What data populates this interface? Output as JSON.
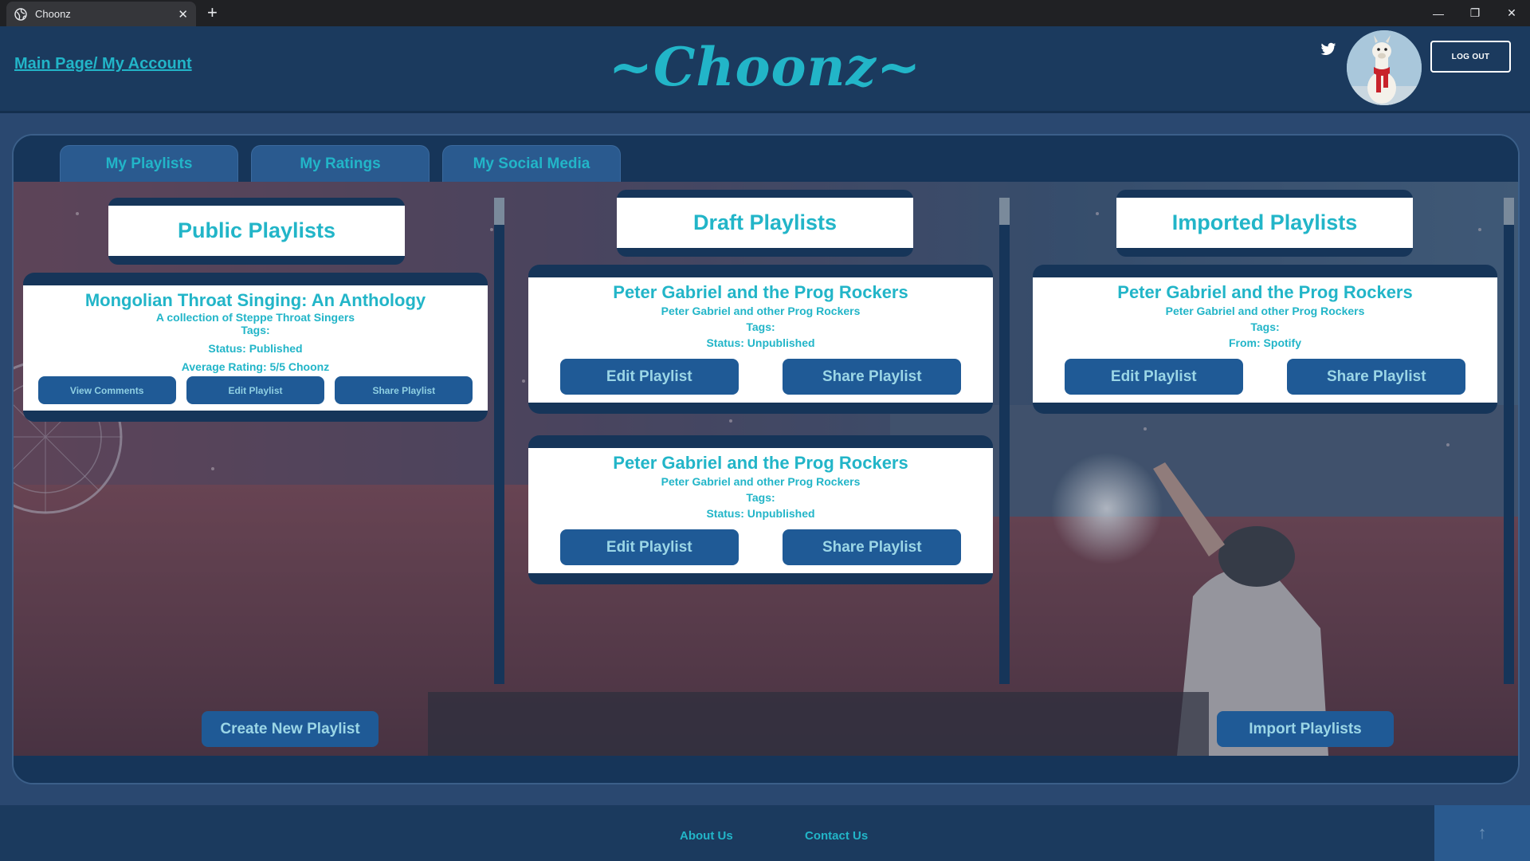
{
  "browser": {
    "tab_title": "Choonz",
    "new_tab": "+",
    "close_tab": "✕",
    "minimize": "—",
    "restore": "❐",
    "close_window": "✕"
  },
  "header": {
    "nav_link": "Main Page/ My Account",
    "logo": "~Choonz~",
    "logout_label": "LOG OUT",
    "icons": [
      "twitter-icon",
      "avatar"
    ]
  },
  "tabs": [
    {
      "label": "My Playlists"
    },
    {
      "label": "My Ratings"
    },
    {
      "label": "My Social Media"
    }
  ],
  "public": {
    "title": "Public Playlists",
    "cards": [
      {
        "title": "Mongolian Throat Singing: An Anthology",
        "subtitle": "A collection of Steppe Throat Singers",
        "tags": "Tags:",
        "status": "Status: Published",
        "rating": "Average Rating: 5/5 Choonz",
        "buttons": [
          "View Comments",
          "Edit Playlist",
          "Share Playlist"
        ]
      }
    ],
    "action": "Create New Playlist"
  },
  "draft": {
    "title": "Draft Playlists",
    "cards": [
      {
        "title": "Peter Gabriel and the Prog Rockers",
        "subtitle": "Peter Gabriel and other Prog Rockers",
        "tags": "Tags:",
        "status": "Status: Unpublished",
        "buttons": [
          "Edit Playlist",
          "Share Playlist"
        ]
      },
      {
        "title": "Peter Gabriel and the Prog Rockers",
        "subtitle": "Peter Gabriel and other Prog Rockers",
        "tags": "Tags:",
        "status": "Status: Unpublished",
        "buttons": [
          "Edit Playlist",
          "Share Playlist"
        ]
      }
    ]
  },
  "imported": {
    "title": "Imported Playlists",
    "cards": [
      {
        "title": "Peter Gabriel and the Prog Rockers",
        "subtitle": "Peter Gabriel and other Prog Rockers",
        "tags": "Tags:",
        "source": "From: Spotify",
        "buttons": [
          "Edit Playlist",
          "Share Playlist"
        ]
      }
    ],
    "action": "Import Playlists"
  },
  "footer": {
    "about": "About Us",
    "contact": "Contact Us",
    "to_top": "↑"
  },
  "colors": {
    "accent": "#22b5c8",
    "navy": "#1b3a5e",
    "button": "#1f5a96"
  }
}
